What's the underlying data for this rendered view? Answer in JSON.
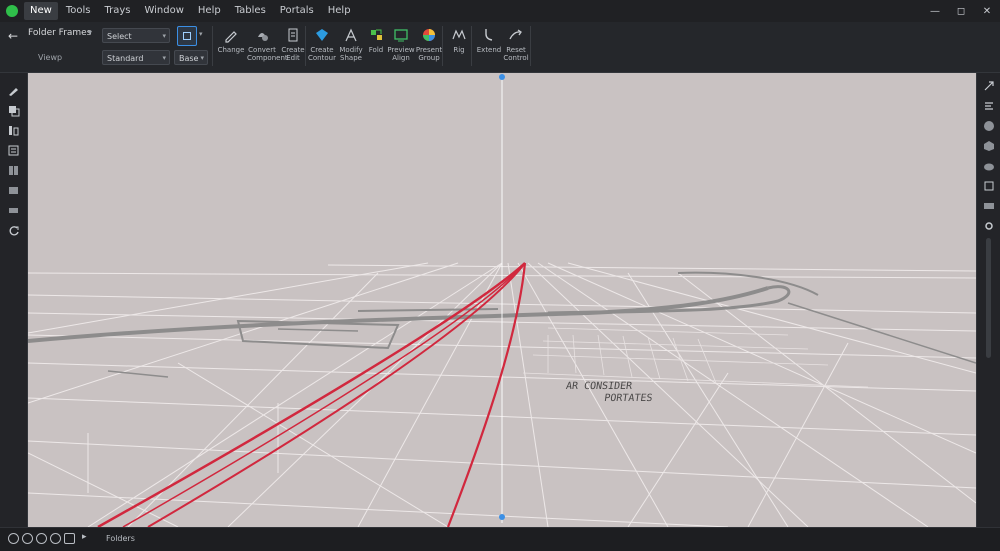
{
  "menu": [
    "New",
    "Tools",
    "Trays",
    "Window",
    "Help",
    "Tables",
    "Portals",
    "Help"
  ],
  "window_controls": [
    "—",
    "◻",
    "✕"
  ],
  "ribbon": {
    "doc_name": "Folder Frames",
    "doc_sub": "Viewp",
    "combo_1": "Select",
    "combo_2": "Standard",
    "combo_3": "Base",
    "tools": [
      {
        "icon": "pencil-icon",
        "label": "Change"
      },
      {
        "icon": "shape-icon",
        "label": "Convert Component"
      },
      {
        "icon": "document-icon",
        "label": "Create Edit"
      },
      {
        "icon": "cube-icon",
        "label": "Create Contour"
      },
      {
        "icon": "split-icon",
        "label": "Modify Shape"
      },
      {
        "icon": "grid-tool-icon",
        "label": "Fold"
      },
      {
        "icon": "monitor-icon",
        "label": "Preview Align"
      },
      {
        "icon": "color-wheel-icon",
        "label": "Present Group"
      },
      {
        "icon": "wave-icon",
        "label": "Rig"
      },
      {
        "icon": "bend-icon",
        "label": "Extend"
      },
      {
        "icon": "curve-arrow-icon",
        "label": "Reset Control"
      }
    ]
  },
  "viewport": {
    "label_line_1": "AR CONSIDER",
    "label_line_2": "PORTATES"
  },
  "status": {
    "text": "Folders"
  },
  "colors": {
    "accent": "#3b8fe5",
    "selection_red": "#d1283e",
    "viewport_bg": "#c9c2c2",
    "ui_bg": "#1f2023"
  }
}
